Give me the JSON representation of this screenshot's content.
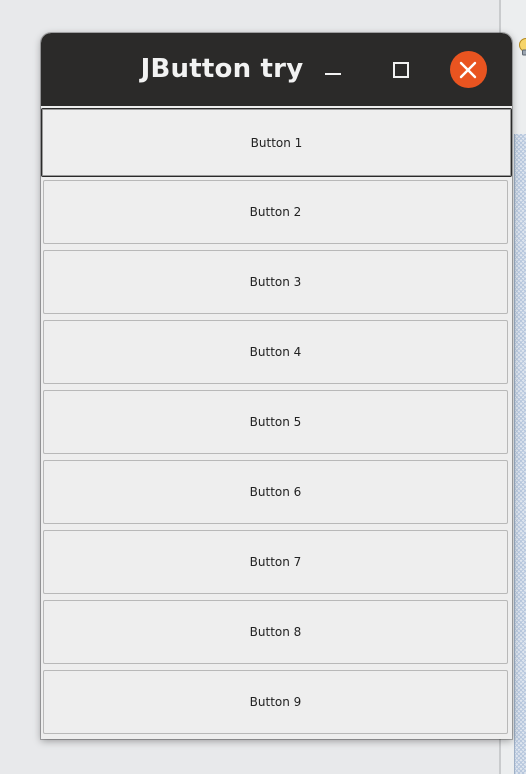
{
  "window": {
    "title": "JButton try",
    "controls": {
      "minimize_icon": "minimize-icon",
      "maximize_icon": "maximize-icon",
      "close_icon": "close-icon"
    },
    "close_color": "#e95420",
    "titlebar_color": "#2b2a29"
  },
  "buttons": [
    {
      "label": "Button 1",
      "focused": true
    },
    {
      "label": "Button 2",
      "focused": false
    },
    {
      "label": "Button 3",
      "focused": false
    },
    {
      "label": "Button 4",
      "focused": false
    },
    {
      "label": "Button 5",
      "focused": false
    },
    {
      "label": "Button 6",
      "focused": false
    },
    {
      "label": "Button 7",
      "focused": false
    },
    {
      "label": "Button 8",
      "focused": false
    },
    {
      "label": "Button 9",
      "focused": false
    }
  ]
}
